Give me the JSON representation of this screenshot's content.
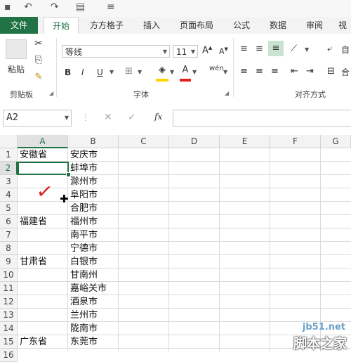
{
  "ribbon_tabs": {
    "file": "文件",
    "home": "开始",
    "fangfang": "方方格子",
    "insert": "插入",
    "layout": "页面布局",
    "formulas": "公式",
    "data": "数据",
    "review": "审阅",
    "view": "视"
  },
  "clipboard": {
    "paste": "粘贴",
    "group": "剪贴板"
  },
  "font": {
    "name": "等线",
    "size": "11",
    "grow": "A",
    "shrink": "A",
    "bold": "B",
    "italic": "I",
    "underline": "U",
    "phonetic": "wén",
    "group": "字体"
  },
  "alignment": {
    "wrap": "自",
    "merge": "合",
    "group": "对齐方式"
  },
  "formula_bar": {
    "name_box": "A2",
    "fx": "fx",
    "value": ""
  },
  "columns": [
    "A",
    "B",
    "C",
    "D",
    "E",
    "F",
    "G"
  ],
  "rows": [
    "1",
    "2",
    "3",
    "4",
    "5",
    "6",
    "7",
    "8",
    "9",
    "10",
    "11",
    "12",
    "13",
    "14",
    "15",
    "16"
  ],
  "cells": {
    "A1": "安徽省",
    "B1": "安庆市",
    "B2": "蚌埠市",
    "B3": "滁州市",
    "B4": "阜阳市",
    "B5": "合肥市",
    "A6": "福建省",
    "B6": "福州市",
    "B7": "南平市",
    "B8": "宁德市",
    "A9": "甘肃省",
    "B9": "白银市",
    "B10": "甘南州",
    "B11": "嘉峪关市",
    "B12": "酒泉市",
    "B13": "兰州市",
    "B14": "陇南市",
    "A16": "广东省",
    "B16": "东莞市"
  },
  "annotation": {
    "checkmark": "✓"
  },
  "watermark": {
    "site": "jb51.net",
    "name": "脚本之家"
  },
  "colors": {
    "accent": "#217346",
    "checkmark": "#e02020"
  }
}
